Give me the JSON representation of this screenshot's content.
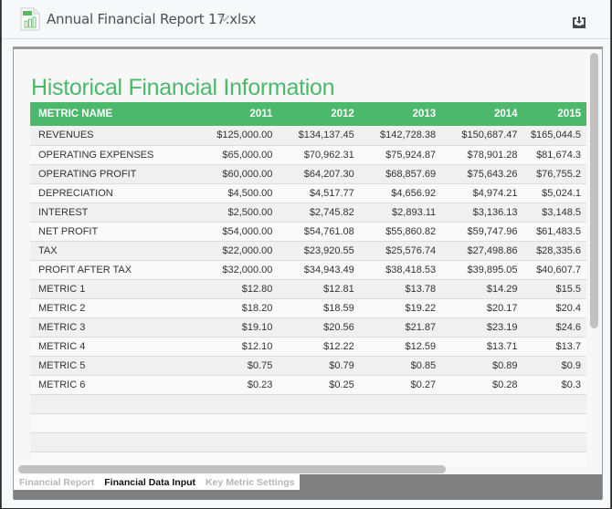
{
  "header": {
    "file_name": "Annual Financial Report 17.xlsx",
    "file_icon": "xlsx-file-icon",
    "file_icon_label": "XLS",
    "dropdown_icon": "chevron-down-icon",
    "download_icon": "download-icon"
  },
  "sheet": {
    "title": "Historical Financial Information",
    "columns": [
      "METRIC NAME",
      "2011",
      "2012",
      "2013",
      "2014",
      "2015"
    ],
    "rows": [
      [
        "REVENUES",
        "$125,000.00",
        "$134,137.45",
        "$142,728.38",
        "$150,687.47",
        "$165,044.5"
      ],
      [
        "OPERATING EXPENSES",
        "$65,000.00",
        "$70,962.31",
        "$75,924.87",
        "$78,901.28",
        "$81,674.3"
      ],
      [
        "OPERATING PROFIT",
        "$60,000.00",
        "$64,207.30",
        "$68,857.69",
        "$75,643.26",
        "$76,755.2"
      ],
      [
        "DEPRECIATION",
        "$4,500.00",
        "$4,517.77",
        "$4,656.92",
        "$4,974.21",
        "$5,024.1"
      ],
      [
        "INTEREST",
        "$2,500.00",
        "$2,745.82",
        "$2,893.11",
        "$3,136.13",
        "$3,148.5"
      ],
      [
        "NET PROFIT",
        "$54,000.00",
        "$54,761.08",
        "$55,860.82",
        "$59,747.96",
        "$61,483.5"
      ],
      [
        "TAX",
        "$22,000.00",
        "$23,920.55",
        "$25,576.74",
        "$27,498.86",
        "$28,335.6"
      ],
      [
        "PROFIT AFTER TAX",
        "$32,000.00",
        "$34,943.49",
        "$38,418.53",
        "$39,895.05",
        "$40,607.7"
      ],
      [
        "METRIC 1",
        "$12.80",
        "$12.81",
        "$13.78",
        "$14.29",
        "$15.5"
      ],
      [
        "METRIC 2",
        "$18.20",
        "$18.59",
        "$19.22",
        "$20.17",
        "$20.4"
      ],
      [
        "METRIC 3",
        "$19.10",
        "$20.56",
        "$21.87",
        "$23.19",
        "$24.6"
      ],
      [
        "METRIC 4",
        "$12.10",
        "$12.22",
        "$12.59",
        "$13.71",
        "$13.7"
      ],
      [
        "METRIC 5",
        "$0.75",
        "$0.79",
        "$0.85",
        "$0.89",
        "$0.9"
      ],
      [
        "METRIC 6",
        "$0.23",
        "$0.25",
        "$0.27",
        "$0.28",
        "$0.3"
      ],
      [
        "",
        "",
        "",
        "",
        "",
        ""
      ],
      [
        "",
        "",
        "",
        "",
        "",
        ""
      ],
      [
        "",
        "",
        "",
        "",
        "",
        ""
      ],
      [
        "",
        "",
        "",
        "",
        "",
        ""
      ]
    ]
  },
  "tabs": [
    {
      "label": "Financial Report",
      "active": false
    },
    {
      "label": "Financial Data Input",
      "active": true
    },
    {
      "label": "Key Metric Settings",
      "active": false
    }
  ],
  "colors": {
    "accent": "#4cb86b",
    "tab_bar": "#808080",
    "scrollbar": "#c1c1c1"
  }
}
